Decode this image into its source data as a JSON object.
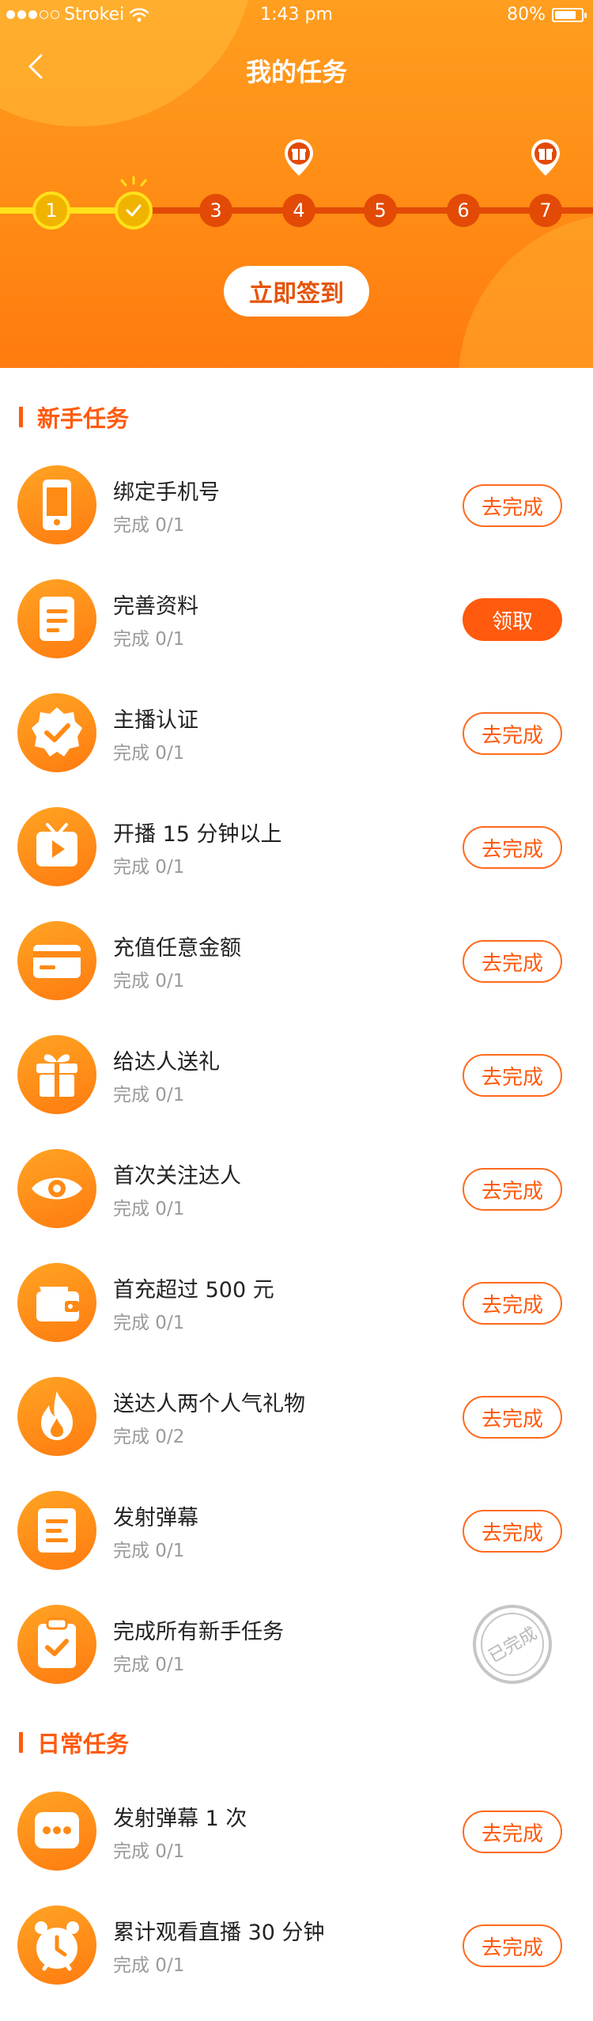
{
  "status_bar": {
    "carrier": "Strokei",
    "time": "1:43 pm",
    "battery": "80%",
    "battery_level": 0.8
  },
  "nav": {
    "title": "我的任务"
  },
  "progress": {
    "steps": [
      "1",
      "2",
      "3",
      "4",
      "5",
      "6",
      "7"
    ],
    "completed": 2,
    "gift_steps": [
      "4",
      "7"
    ]
  },
  "checkin": {
    "label": "立即签到"
  },
  "sections": [
    {
      "title": "新手任务",
      "tasks": [
        {
          "icon": "phone-icon",
          "title": "绑定手机号",
          "status": "完成 0/1",
          "action": "去完成",
          "action_type": "outline"
        },
        {
          "icon": "document-icon",
          "title": "完善资料",
          "status": "完成 0/1",
          "action": "领取",
          "action_type": "fill"
        },
        {
          "icon": "badge-check-icon",
          "title": "主播认证",
          "status": "完成 0/1",
          "action": "去完成",
          "action_type": "outline"
        },
        {
          "icon": "tv-play-icon",
          "title": "开播 15 分钟以上",
          "status": "完成 0/1",
          "action": "去完成",
          "action_type": "outline"
        },
        {
          "icon": "card-icon",
          "title": "充值任意金额",
          "status": "完成 0/1",
          "action": "去完成",
          "action_type": "outline"
        },
        {
          "icon": "gift-icon",
          "title": "给达人送礼",
          "status": "完成 0/1",
          "action": "去完成",
          "action_type": "outline"
        },
        {
          "icon": "eye-icon",
          "title": "首次关注达人",
          "status": "完成 0/1",
          "action": "去完成",
          "action_type": "outline"
        },
        {
          "icon": "wallet-icon",
          "title": "首充超过 500 元",
          "status": "完成 0/1",
          "action": "去完成",
          "action_type": "outline"
        },
        {
          "icon": "fire-icon",
          "title": "送达人两个人气礼物",
          "status": "完成 0/2",
          "action": "去完成",
          "action_type": "outline"
        },
        {
          "icon": "list-icon",
          "title": "发射弹幕",
          "status": "完成 0/1",
          "action": "去完成",
          "action_type": "outline"
        },
        {
          "icon": "clipboard-check-icon",
          "title": "完成所有新手任务",
          "status": "完成 0/1",
          "action": "已完成",
          "action_type": "stamp"
        }
      ]
    },
    {
      "title": "日常任务",
      "tasks": [
        {
          "icon": "chat-dots-icon",
          "title": "发射弹幕 1 次",
          "status": "完成 0/1",
          "action": "去完成",
          "action_type": "outline"
        },
        {
          "icon": "alarm-clock-icon",
          "title": "累计观看直播 30 分钟",
          "status": "完成 0/1",
          "action": "去完成",
          "action_type": "outline"
        }
      ]
    }
  ],
  "colors": {
    "header": "#ff8a14",
    "accent": "#ff5a0d",
    "track_done": "#ffe11a",
    "track_rest": "#e24a06",
    "muted": "#9a9a9a"
  }
}
